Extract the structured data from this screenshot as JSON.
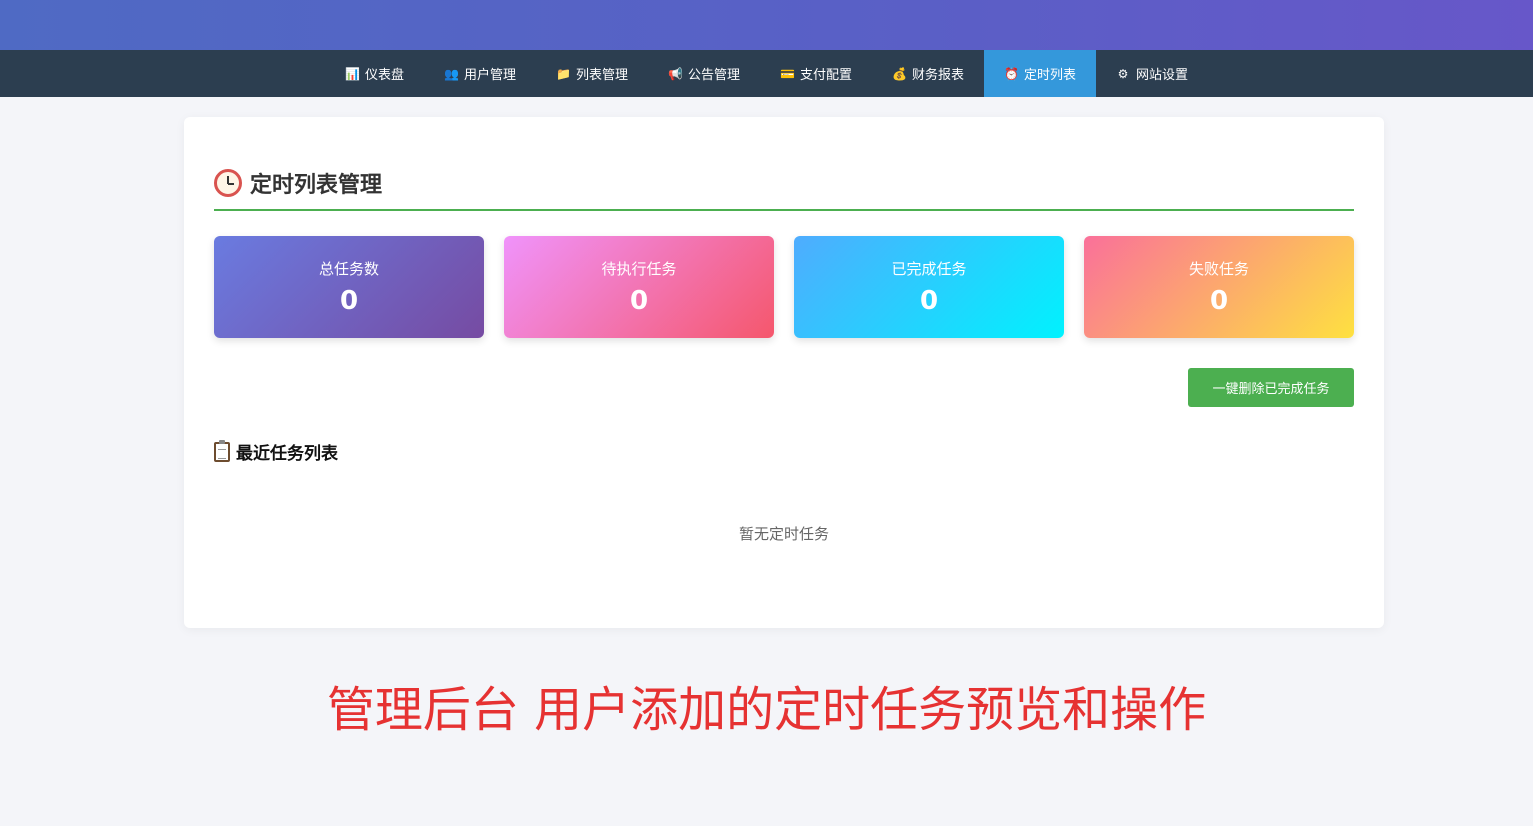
{
  "nav": {
    "items": [
      {
        "icon": "bar-chart-icon",
        "glyph": "📊",
        "label": "仪表盘",
        "active": false
      },
      {
        "icon": "users-icon",
        "glyph": "👥",
        "label": "用户管理",
        "active": false
      },
      {
        "icon": "folder-icon",
        "glyph": "📁",
        "label": "列表管理",
        "active": false
      },
      {
        "icon": "megaphone-icon",
        "glyph": "📢",
        "label": "公告管理",
        "active": false
      },
      {
        "icon": "credit-card-icon",
        "glyph": "💳",
        "label": "支付配置",
        "active": false
      },
      {
        "icon": "money-bag-icon",
        "glyph": "💰",
        "label": "财务报表",
        "active": false
      },
      {
        "icon": "alarm-clock-icon",
        "glyph": "⏰",
        "label": "定时列表",
        "active": true
      },
      {
        "icon": "gear-icon",
        "glyph": "⚙",
        "label": "网站设置",
        "active": false
      }
    ],
    "active_color": "#3498db",
    "background": "#2c3e50"
  },
  "page": {
    "title": "定时列表管理",
    "title_icon": "alarm-clock-icon"
  },
  "stats": [
    {
      "label": "总任务数",
      "value": "0"
    },
    {
      "label": "待执行任务",
      "value": "0"
    },
    {
      "label": "已完成任务",
      "value": "0"
    },
    {
      "label": "失败任务",
      "value": "0"
    }
  ],
  "actions": {
    "delete_completed_label": "一键删除已完成任务",
    "button_color": "#4caf50"
  },
  "recent": {
    "title": "最近任务列表",
    "icon": "clipboard-icon",
    "empty_text": "暂无定时任务"
  },
  "caption": "管理后台 用户添加的定时任务预览和操作"
}
